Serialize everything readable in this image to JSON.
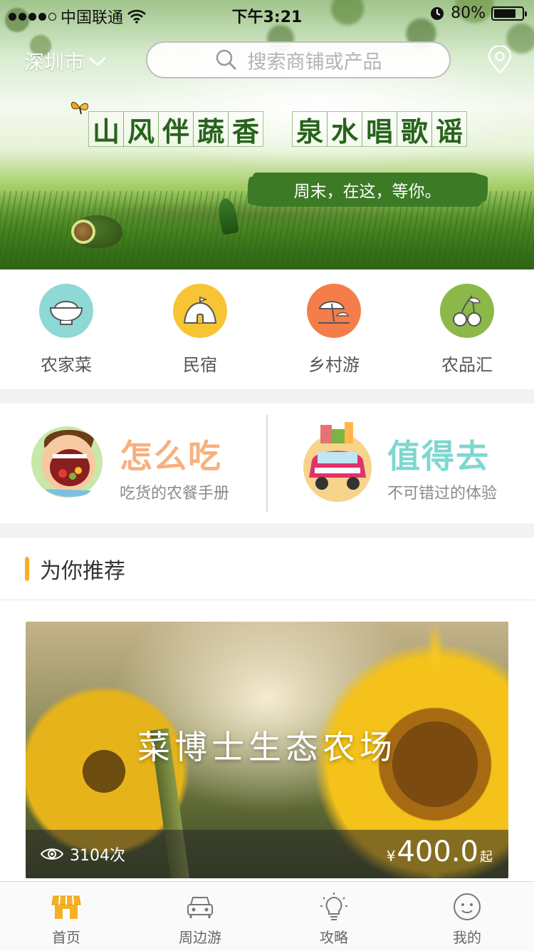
{
  "status_bar": {
    "carrier": "中国联通",
    "time": "下午3:21",
    "battery": "80%",
    "battery_level": 0.8
  },
  "header": {
    "city": "深圳市",
    "search_placeholder": "搜索商铺或产品"
  },
  "banner": {
    "slogan_left": [
      "山",
      "风",
      "伴",
      "蔬",
      "香"
    ],
    "slogan_right": [
      "泉",
      "水",
      "唱",
      "歌",
      "谣"
    ],
    "tagline": "周末，在这，等你。"
  },
  "categories": [
    {
      "label": "农家菜",
      "icon": "rice-bowl-icon",
      "color": "#8ed8d5"
    },
    {
      "label": "民宿",
      "icon": "tent-icon",
      "color": "#f7c534"
    },
    {
      "label": "乡村游",
      "icon": "beach-umbrella-icon",
      "color": "#f47d4a"
    },
    {
      "label": "农品汇",
      "icon": "cherry-icon",
      "color": "#8cb84a"
    }
  ],
  "promos": [
    {
      "title": "怎么吃",
      "subtitle": "吃货的农餐手册",
      "color": "#f8b07d"
    },
    {
      "title": "值得去",
      "subtitle": "不可错过的体验",
      "color": "#7dd8cf"
    }
  ],
  "recommend": {
    "title": "为你推荐",
    "card": {
      "name": "菜博士生态农场",
      "views": "3104次",
      "currency": "¥",
      "price": "400.0",
      "price_suffix": "起"
    }
  },
  "tabbar": [
    {
      "label": "首页",
      "icon": "shop-icon",
      "active": true
    },
    {
      "label": "周边游",
      "icon": "car-icon",
      "active": false
    },
    {
      "label": "攻略",
      "icon": "lightbulb-icon",
      "active": false
    },
    {
      "label": "我的",
      "icon": "smiley-icon",
      "active": false
    }
  ],
  "colors": {
    "accent": "#f6b026",
    "separator": "#f2f2f2"
  }
}
